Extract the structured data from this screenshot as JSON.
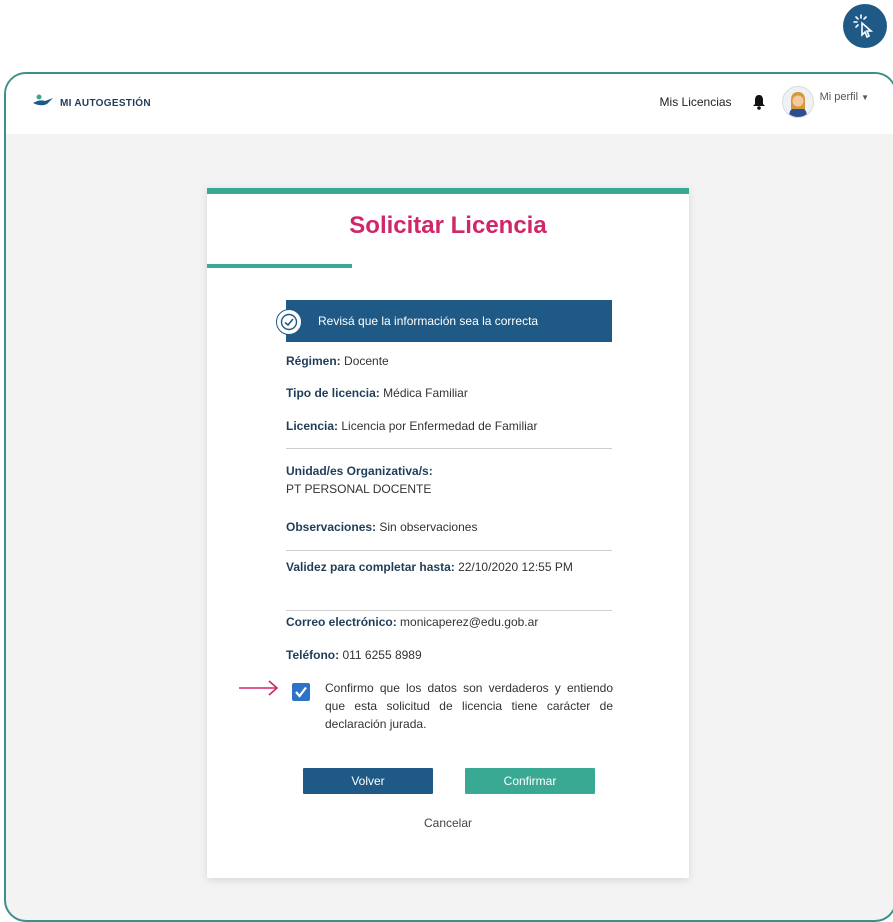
{
  "header": {
    "brand": "MI AUTOGESTIÓN",
    "nav_link": "Mis Licencias",
    "profile_label": "Mi perfil"
  },
  "card": {
    "title": "Solicitar Licencia",
    "banner_text": "Revisá que la información sea la correcta",
    "fields": {
      "regimen_label": "Régimen:",
      "regimen_value": "Docente",
      "tipo_label": "Tipo de licencia:",
      "tipo_value": "Médica Familiar",
      "licencia_label": "Licencia:",
      "licencia_value": "Licencia por Enfermedad de Familiar",
      "unidad_label": "Unidad/es Organizativa/s:",
      "unidad_value": "PT PERSONAL DOCENTE",
      "obs_label": "Observaciones:",
      "obs_value": "Sin observaciones",
      "validez_label": "Validez para completar hasta:",
      "validez_value": "22/10/2020 12:55 PM",
      "correo_label": "Correo electrónico:",
      "correo_value": "monicaperez@edu.gob.ar",
      "telefono_label": "Teléfono:",
      "telefono_value": "011 6255 8989"
    },
    "confirm_text": "Confirmo que los datos son verdaderos y entiendo que esta solicitud de licencia tiene carácter de declaración jurada.",
    "confirm_checked": true,
    "back_button": "Volver",
    "confirm_button": "Confirmar",
    "cancel_link": "Cancelar"
  },
  "colors": {
    "primary_blue": "#1f5a86",
    "teal": "#3aa993",
    "title_pink": "#d0266a",
    "arrow_pink": "#d0266a",
    "frame_teal": "#3e8f8a"
  },
  "icons": [
    "click-cursor-icon",
    "brand-logo-icon",
    "bell-icon",
    "avatar",
    "check-circle-icon",
    "checkmark-icon",
    "arrow-right-icon"
  ]
}
